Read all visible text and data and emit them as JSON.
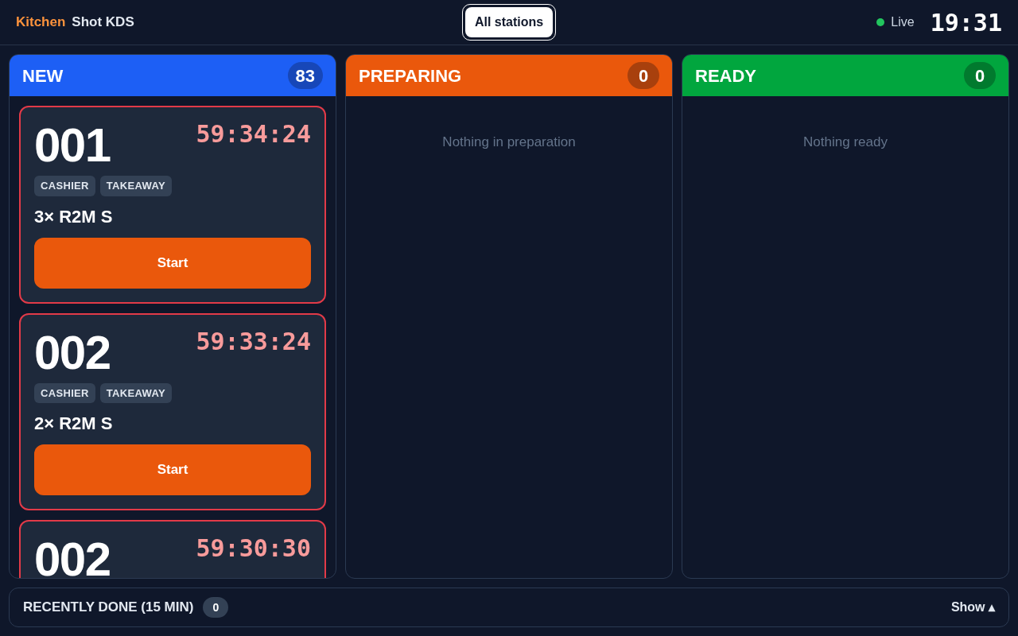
{
  "header": {
    "brand_accent": "Kitchen",
    "brand": "Shot KDS",
    "station_button": "All stations",
    "live": true,
    "status": "Live",
    "clock": "19:31"
  },
  "columns": [
    {
      "kind": "new",
      "title": "NEW",
      "count": "83",
      "orders": [
        {
          "number": "001",
          "timer": "59:34:24",
          "overdue": true,
          "tags": [
            "CASHIER",
            "TAKEAWAY"
          ],
          "items": [
            "3× R2M S"
          ],
          "action": "Start"
        },
        {
          "number": "002",
          "timer": "59:33:24",
          "overdue": true,
          "tags": [
            "CASHIER",
            "TAKEAWAY"
          ],
          "items": [
            "2× R2M S"
          ],
          "action": "Start"
        },
        {
          "number": "002",
          "timer": "59:30:30",
          "overdue": true
        }
      ]
    },
    {
      "kind": "preparing",
      "title": "PREPARING",
      "count": "0",
      "empty_text": "Nothing in preparation"
    },
    {
      "kind": "ready",
      "title": "READY",
      "count": "0",
      "empty_text": "Nothing ready"
    }
  ],
  "footer": {
    "title": "RECENTLY DONE (15 MIN)",
    "count": "0",
    "toggle": "Show ▴"
  }
}
